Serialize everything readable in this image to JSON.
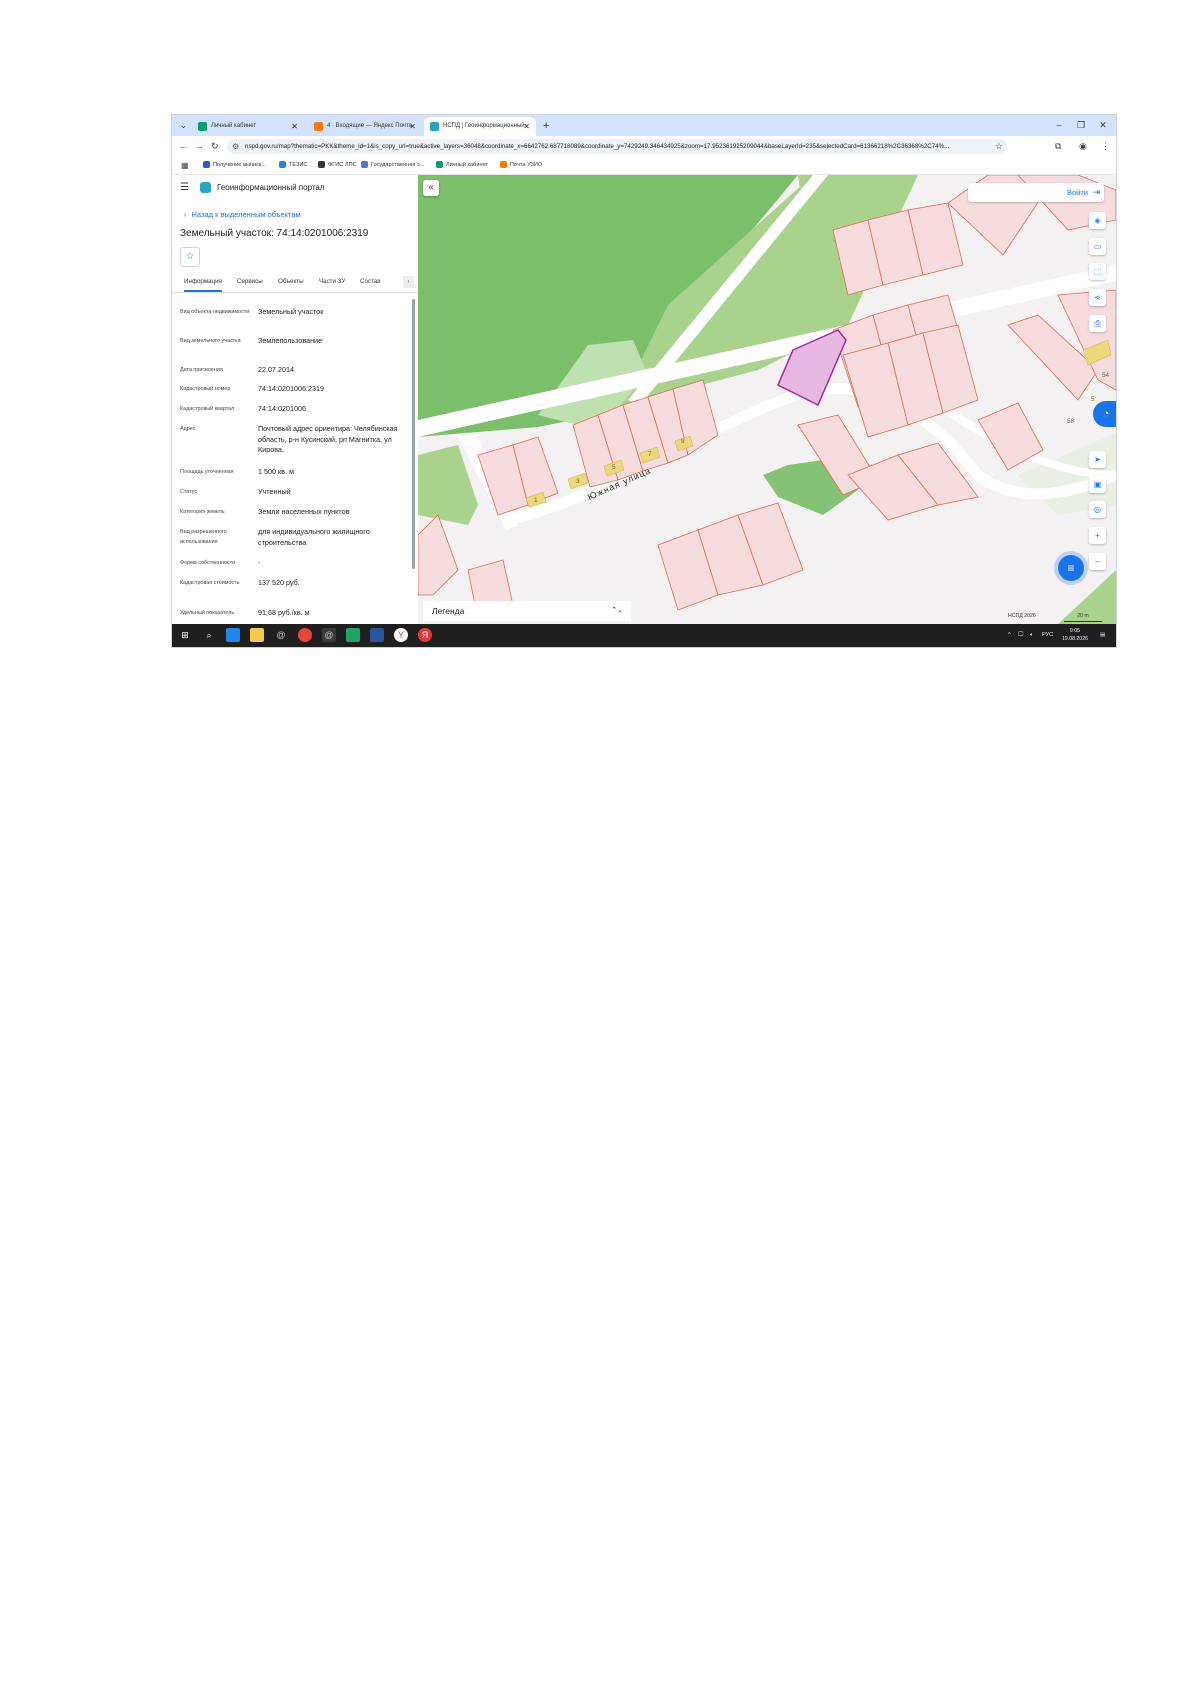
{
  "browser": {
    "tabs": [
      {
        "label": "Личный кабинет",
        "favicon_color": "#0a9e6f"
      },
      {
        "label": "4 · Входящие — Яндекс Почта",
        "favicon_color": "#ff7a00"
      },
      {
        "label": "НСПД | Геоинформационный",
        "favicon_color": "#2aa3c5"
      }
    ],
    "url": "nspd.gov.ru/map?thematic=PKK&theme_id=1&is_copy_url=true&active_layers=36048&coordinate_x=6642762.687718089&coordinate_y=7429249.346434925&zoom=17.952361925209044&baseLayerId=235&selectedCard=61366218%2C36368%2C74%...",
    "bookmarks": [
      {
        "label": "Получение выписк...",
        "color": "#3559c8"
      },
      {
        "label": "ТЕЗИС",
        "color": "#1e88e5"
      },
      {
        "label": "ФГИС ЛПС",
        "color": "#333333"
      },
      {
        "label": "Государственная э...",
        "color": "#4a7bd0"
      },
      {
        "label": "Личный кабинет",
        "color": "#0a9e6f"
      },
      {
        "label": "Почта УЗИО",
        "color": "#ff7a00"
      }
    ]
  },
  "portal": {
    "title": "Геоинформационный портал",
    "back_link": "Назад к выделенным объектам",
    "object_title": "Земельный участок: 74:14:0201006:2319",
    "tabs": [
      "Информация",
      "Сервисы",
      "Объекты",
      "Части ЗУ",
      "Состав"
    ],
    "info_rows": [
      {
        "key": "Вид объекта недвижимости",
        "value": "Земельный участок"
      },
      {
        "key": "Вид земельного участка",
        "value": "Землепользование"
      },
      {
        "key": "Дата присвоения",
        "value": "22.07.2014"
      },
      {
        "key": "Кадастровый номер",
        "value": "74:14:0201006:2319"
      },
      {
        "key": "Кадастровый квартал",
        "value": "74:14:0201006"
      },
      {
        "key": "Адрес",
        "value": "Почтовый адрес ориентира: Челябинская область, р-н Кусинский, рп Магнитка, ул Кирова,"
      },
      {
        "key": "Площадь уточненная",
        "value": "1 500 кв. м"
      },
      {
        "key": "Статус",
        "value": "Учтенный"
      },
      {
        "key": "Категория земель",
        "value": "Земли населенных пунктов"
      },
      {
        "key": "Вид разрешенного использования",
        "value": "для индивидуального жилищного строительства"
      },
      {
        "key": "Форма собственности",
        "value": "-"
      },
      {
        "key": "Кадастровая стоимость",
        "value": "137 520 руб."
      },
      {
        "key": "Удельный показатель",
        "value": "91,68 руб./кв. м"
      }
    ]
  },
  "map": {
    "login_label": "Войти",
    "legend_label": "Легенда",
    "street_label": "Южная улица",
    "house_numbers": [
      "1",
      "3",
      "5",
      "7",
      "9",
      "54",
      "58",
      "5"
    ],
    "attribution": "НСПД 2026",
    "scale_label": "20 m",
    "colors": {
      "forest": "#7bbf6a",
      "meadow": "#a9d38d",
      "road": "#ffffff",
      "parcel": "#e46a52",
      "selected": "#a12aa0"
    }
  },
  "taskbar": {
    "lang": "РУС",
    "time": "9:05",
    "date": "19.08.2026"
  }
}
